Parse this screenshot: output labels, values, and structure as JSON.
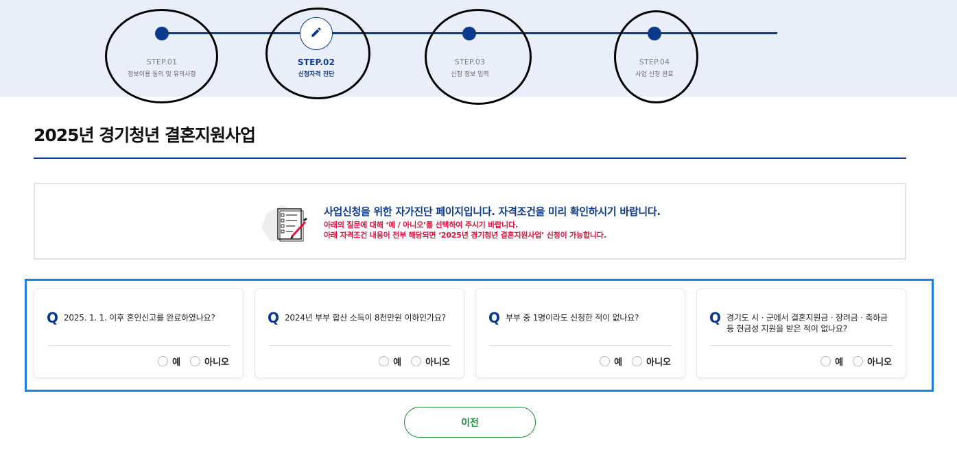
{
  "stepper": {
    "steps": [
      {
        "title": "STEP.01",
        "sub": "정보이용 동의 및 유의사항"
      },
      {
        "title": "STEP.02",
        "sub": "신청자격 진단"
      },
      {
        "title": "STEP.03",
        "sub": "신청 정보 입력"
      },
      {
        "title": "STEP.04",
        "sub": "사업 신청 완료"
      }
    ],
    "active_step": 2,
    "active_icon": "pencil-icon"
  },
  "page": {
    "title": "2025년 경기청년 결혼지원사업"
  },
  "notice": {
    "icon": "checklist-document-icon",
    "heading": "사업신청을 위한 자가진단 페이지입니다. 자격조건을 미리 확인하시기 바랍니다.",
    "line1": "아래의 질문에 대해 ‘예 / 아니오’를 선택하여 주시기 바랍니다.",
    "line2": "아래 자격조건 내용이 전부 해당되면 ‘2025년 경기청년 결혼지원사업’ 신청이 가능합니다."
  },
  "questions": [
    {
      "mark": "Q",
      "text": "2025. 1. 1. 이후 혼인신고를 완료하였나요?",
      "yes": "예",
      "no": "아니오"
    },
    {
      "mark": "Q",
      "text": "2024년 부부 합산 소득이 8천만원 이하인가요?",
      "yes": "예",
      "no": "아니오"
    },
    {
      "mark": "Q",
      "text": "부부 중 1명이라도 신청한 적이 없나요?",
      "yes": "예",
      "no": "아니오"
    },
    {
      "mark": "Q",
      "text": "경기도 시ㆍ군에서 결혼지원금ㆍ장려금ㆍ축하금 등 현금성 지원을 받은 적이 없나요?",
      "yes": "예",
      "no": "아니오"
    }
  ],
  "actions": {
    "prev_label": "이전"
  },
  "colors": {
    "navy": "#0b3a8a",
    "red_notice": "#e0123b",
    "green_button": "#1e8a3e",
    "highlight_outline": "#1a7fe0",
    "band_bg": "#e9eef8"
  }
}
